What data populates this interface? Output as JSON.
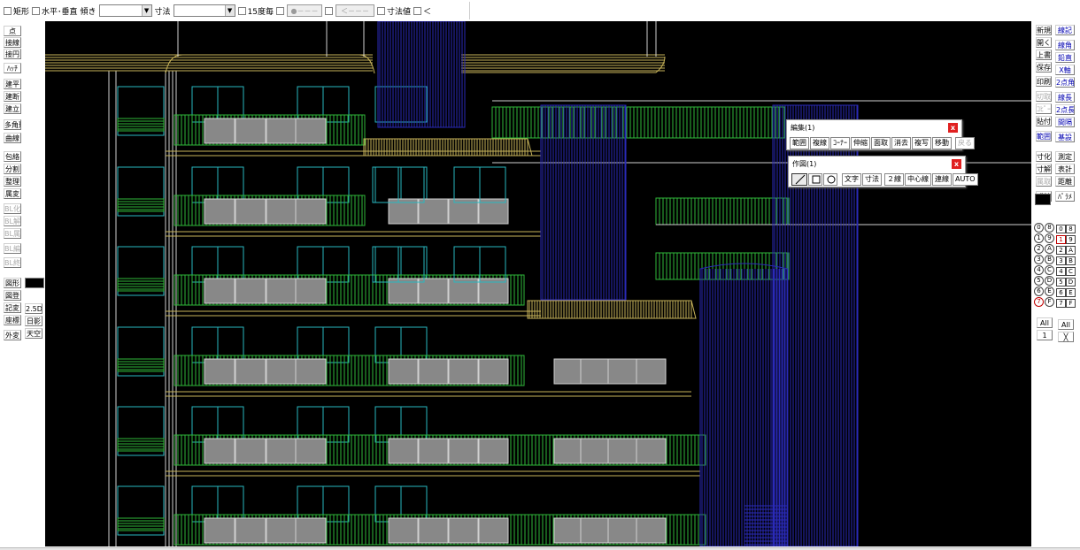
{
  "topbar": {
    "rect_label": "矩形",
    "hv_label": "水平･垂直",
    "slope_label": "傾き",
    "dim_label": "寸法",
    "deg15_label": "15度毎",
    "btn1_label": "●－－－",
    "btn2_label": "＜－－－",
    "dimval_label": "寸法値",
    "lt_label": "＜"
  },
  "left_tools": [
    "点",
    "接線",
    "接円",
    "ﾊｯﾁ",
    "建平",
    "建断",
    "建立",
    "多角形",
    "曲線",
    "包絡",
    "分割",
    "整理",
    "属変",
    "BL化",
    "BL解",
    "BL属",
    "BL編",
    "BL終",
    "図形",
    "図登",
    "記変",
    "座標",
    "外変"
  ],
  "left_extra": {
    "d25": "2.5D",
    "sun": "日影",
    "sky": "天空"
  },
  "right_tools_a": [
    "新規",
    "開く",
    "上書",
    "保存",
    "印刷",
    "切取",
    "ｺﾋﾟｰ",
    "貼付",
    "範囲",
    "寸化",
    "寸解",
    "属取",
    "式計"
  ],
  "right_tools_b": [
    "線記",
    "線角",
    "鉛直",
    "X軸",
    "2点角",
    "線長",
    "2点長",
    "間隔",
    "基設",
    "測定",
    "表計",
    "距離",
    "ﾊﾟﾗﾒ"
  ],
  "right_disabled": [
    "切取",
    "ｺﾋﾟｰ",
    "属取"
  ],
  "layers_circle": [
    "0",
    "8",
    "1",
    "9",
    "2",
    "A",
    "3",
    "B",
    "4",
    "C",
    "5",
    "D",
    "6",
    "E",
    "7",
    "F"
  ],
  "layers_square": [
    "0",
    "8",
    "1",
    "9",
    "2",
    "A",
    "3",
    "B",
    "4",
    "C",
    "5",
    "D",
    "6",
    "E",
    "7",
    "F"
  ],
  "layer_all": "All",
  "group_all": "All",
  "layer_one": "1",
  "group_x": "╳",
  "edit_dialog": {
    "title": "編集(1)",
    "buttons": [
      "範囲",
      "複線",
      "ｺｰﾅｰ",
      "伸縮",
      "面取",
      "消去",
      "複写",
      "移動",
      "戻る"
    ]
  },
  "draw_dialog": {
    "title": "作図(1)",
    "shape_icons": [
      "line-icon",
      "rect-icon",
      "circle-icon"
    ],
    "buttons": [
      "文字",
      "寸法",
      "２線",
      "中心線",
      "連線",
      "AUTO"
    ]
  },
  "close_glyph": "x",
  "colors": {
    "canvas": "#000000",
    "yellow": "#c8b45a",
    "green": "#2fb83a",
    "cyan": "#29b8c0",
    "blue": "#2a2ab8",
    "gray": "#888888",
    "white": "#d0d0d0"
  }
}
